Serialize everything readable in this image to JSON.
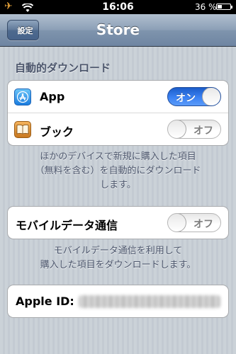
{
  "statusbar": {
    "time": "16:06",
    "battery": "36 %"
  },
  "navbar": {
    "back_label": "設定",
    "title": "Store"
  },
  "auto_download": {
    "header": "自動的ダウンロード",
    "items": [
      {
        "label": "App",
        "toggle": "オン",
        "state": "on"
      },
      {
        "label": "ブック",
        "toggle": "オフ",
        "state": "off"
      }
    ],
    "footer_lines": [
      "ほかのデバイスで新規に購入した項目",
      "（無料を含む）を自動的にダウンロード",
      "します。"
    ]
  },
  "cellular": {
    "label": "モバイルデータ通信",
    "toggle": "オフ",
    "state": "off",
    "footer_lines": [
      "モバイルデータ通信を利用して",
      "購入した項目をダウンロードします。"
    ]
  },
  "apple_id": {
    "label": "Apple ID:"
  },
  "colors": {
    "toggle_on": "#3b82f4",
    "nav": "#6e85a2",
    "background": "#c5ccd4"
  }
}
